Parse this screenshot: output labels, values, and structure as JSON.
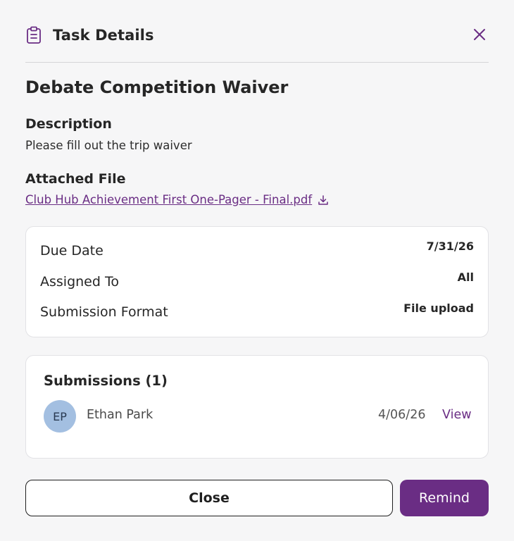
{
  "header": {
    "title": "Task Details",
    "icon": "clipboard-icon",
    "close_icon": "close-icon"
  },
  "task": {
    "title": "Debate Competition Waiver",
    "description_label": "Description",
    "description": "Please fill out the trip waiver",
    "attached_label": "Attached File",
    "file_name": "Club Hub Achievement First One-Pager - Final.pdf",
    "file_icon": "download-icon"
  },
  "details": {
    "rows": [
      {
        "label": "Due Date",
        "value": "7/31/26"
      },
      {
        "label": "Assigned To",
        "value": "All"
      },
      {
        "label": "Submission Format",
        "value": "File upload"
      }
    ]
  },
  "submissions": {
    "title": "Submissions (1)",
    "items": [
      {
        "initials": "EP",
        "name": "Ethan Park",
        "date": "4/06/26",
        "action": "View"
      }
    ]
  },
  "footer": {
    "close_label": "Close",
    "remind_label": "Remind"
  },
  "colors": {
    "accent": "#6a2d84",
    "background": "#f6f6f7",
    "card": "#ffffff",
    "avatar": "#a3bfe1"
  }
}
